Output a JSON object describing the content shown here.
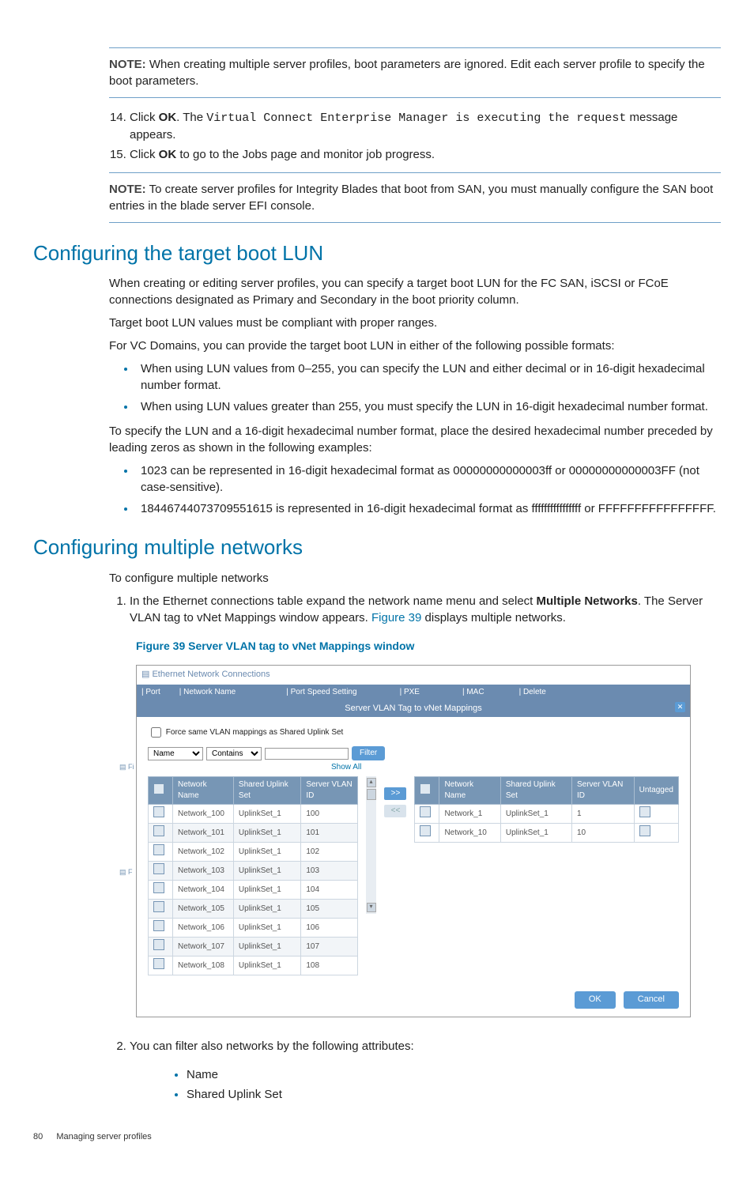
{
  "note1": {
    "label": "NOTE:",
    "text": "When creating multiple server profiles, boot parameters are ignored. Edit each server profile to specify the boot parameters."
  },
  "step14": {
    "num": "14.",
    "pre": "Click ",
    "ok": "OK",
    ". ": "",
    "post1": ". The ",
    "code": "Virtual Connect Enterprise Manager is executing the request",
    "post2": "message appears."
  },
  "step15": {
    "text": "Click ",
    "ok": "OK",
    "post": " to go to the Jobs page and monitor job progress."
  },
  "note2": {
    "label": "NOTE:",
    "text": "To create server profiles for Integrity Blades that boot from SAN, you must manually configure the SAN boot entries in the blade server EFI console."
  },
  "h2a": "Configuring the target boot LUN",
  "p1": "When creating or editing server profiles, you can specify a target boot LUN for the FC SAN, iSCSI or FCoE connections designated as Primary and Secondary in the boot priority column.",
  "p2": "Target boot LUN values must be compliant with proper ranges.",
  "p3": "For VC Domains, you can provide the target boot LUN in either of the following possible formats:",
  "b1": "When using LUN values from 0–255, you can specify the LUN and either decimal or in 16-digit hexadecimal number format.",
  "b2": "When using LUN values greater than 255, you must specify the LUN in 16-digit hexadecimal number format.",
  "p4": "To specify the LUN and a 16-digit hexadecimal number format, place the desired hexadecimal number preceded by leading zeros as shown in the following examples:",
  "b3": "1023 can be represented in 16-digit hexadecimal format as 00000000000003ff or 00000000000003FF (not case-sensitive).",
  "b4": "18446744073709551615 is represented in 16-digit hexadecimal format as ffffffffffffffff or FFFFFFFFFFFFFFFF.",
  "h2b": "Configuring multiple networks",
  "p5": "To configure multiple networks",
  "s1a": "In the Ethernet connections table expand the network name menu and select ",
  "s1b": "Multiple Networks",
  "s1c": ". The Server VLAN tag to vNet Mappings window appears. ",
  "s1link": "Figure 39",
  "s1d": " displays multiple networks.",
  "figcap": "Figure 39 Server VLAN tag to vNet Mappings window",
  "shot": {
    "title": "Ethernet Network Connections",
    "tabs": [
      "| Port",
      "| Network Name",
      "| Port Speed Setting",
      "| PXE",
      "| MAC",
      "| Delete"
    ],
    "subtitle": "Server VLAN Tag to vNet Mappings",
    "force": "Force same VLAN mappings as Shared Uplink Set",
    "namecol": "Name",
    "contains": "Contains",
    "filter": "Filter",
    "showall": "Show All",
    "th1": [
      "",
      "Network Name",
      "Shared Uplink Set",
      "Server VLAN ID"
    ],
    "rows": [
      [
        "Network_100",
        "UplinkSet_1",
        "100"
      ],
      [
        "Network_101",
        "UplinkSet_1",
        "101"
      ],
      [
        "Network_102",
        "UplinkSet_1",
        "102"
      ],
      [
        "Network_103",
        "UplinkSet_1",
        "103"
      ],
      [
        "Network_104",
        "UplinkSet_1",
        "104"
      ],
      [
        "Network_105",
        "UplinkSet_1",
        "105"
      ],
      [
        "Network_106",
        "UplinkSet_1",
        "106"
      ],
      [
        "Network_107",
        "UplinkSet_1",
        "107"
      ],
      [
        "Network_108",
        "UplinkSet_1",
        "108"
      ]
    ],
    "th2": [
      "",
      "Network Name",
      "Shared Uplink Set",
      "Server VLAN ID",
      "Untagged"
    ],
    "rows2": [
      [
        "Network_1",
        "UplinkSet_1",
        "1"
      ],
      [
        "Network_10",
        "UplinkSet_1",
        "10"
      ]
    ],
    "okbtn": "OK",
    "cancel": "Cancel"
  },
  "s2": "You can filter also networks by the following attributes:",
  "s2a": "Name",
  "s2b": "Shared Uplink Set",
  "footer": {
    "page": "80",
    "title": "Managing server profiles"
  }
}
